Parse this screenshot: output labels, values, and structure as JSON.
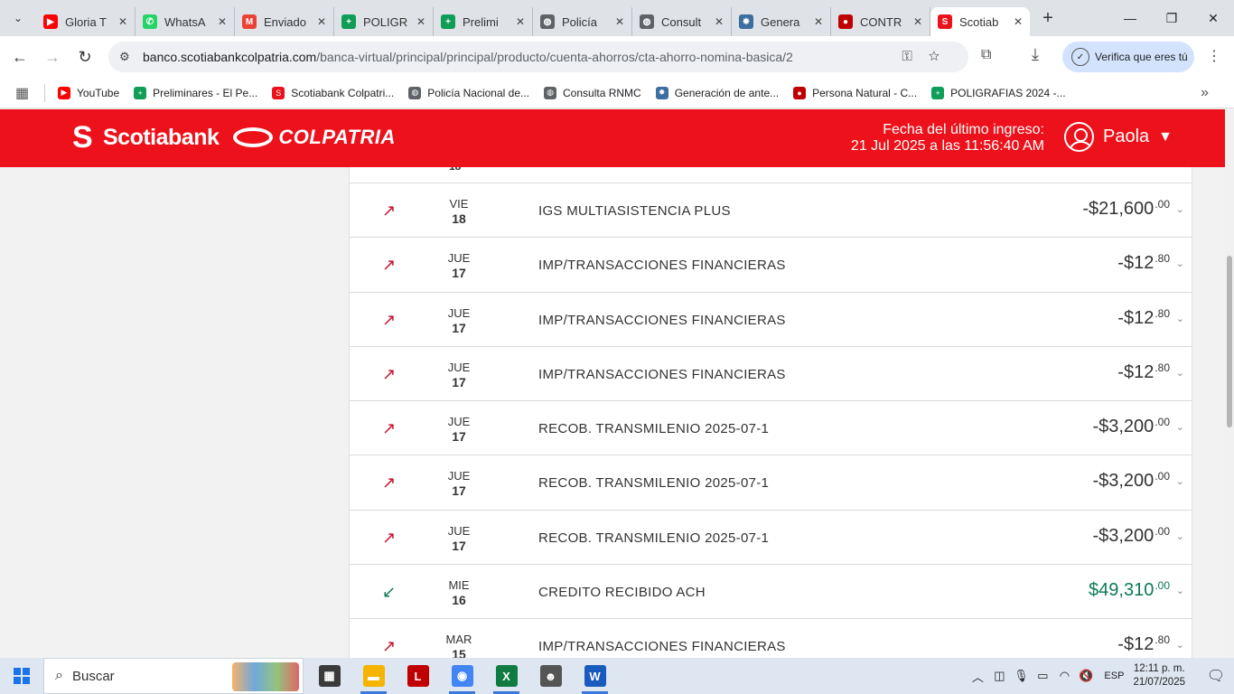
{
  "browser": {
    "tabs": [
      {
        "title": "Gloria T",
        "fav_color": "#ff0000",
        "fav_glyph": "▶"
      },
      {
        "title": "WhatsA",
        "fav_color": "#25d366",
        "fav_glyph": "✆"
      },
      {
        "title": "Enviado",
        "fav_color": "#ea4335",
        "fav_glyph": "M"
      },
      {
        "title": "POLIGR",
        "fav_color": "#0f9d58",
        "fav_glyph": "+"
      },
      {
        "title": "Prelimi",
        "fav_color": "#0f9d58",
        "fav_glyph": "+"
      },
      {
        "title": "Policía",
        "fav_color": "#5f6368",
        "fav_glyph": "◍"
      },
      {
        "title": "Consult",
        "fav_color": "#5f6368",
        "fav_glyph": "◍"
      },
      {
        "title": "Genera",
        "fav_color": "#3c6e9f",
        "fav_glyph": "✸"
      },
      {
        "title": "CONTR",
        "fav_color": "#c00000",
        "fav_glyph": "●"
      },
      {
        "title": "Scotiab",
        "fav_color": "#ec111a",
        "fav_glyph": "S",
        "active": true
      }
    ],
    "url_host": "banco.scotiabankcolpatria.com",
    "url_path": "/banca-virtual/principal/principal/producto/cuenta-ahorros/cta-ahorro-nomina-basica/2",
    "verify_label": "Verifica que eres tú",
    "bookmarks": [
      {
        "label": "YouTube",
        "color": "#ff0000",
        "glyph": "▶"
      },
      {
        "label": "Preliminares - El Pe...",
        "color": "#0f9d58",
        "glyph": "+"
      },
      {
        "label": "Scotiabank Colpatri...",
        "color": "#ec111a",
        "glyph": "S"
      },
      {
        "label": "Policía Nacional de...",
        "color": "#5f6368",
        "glyph": "◍"
      },
      {
        "label": "Consulta RNMC",
        "color": "#5f6368",
        "glyph": "◍"
      },
      {
        "label": "Generación de ante...",
        "color": "#3c6e9f",
        "glyph": "✸"
      },
      {
        "label": "Persona Natural - C...",
        "color": "#c00000",
        "glyph": "●"
      },
      {
        "label": "POLIGRAFIAS 2024 -...",
        "color": "#0f9d58",
        "glyph": "+"
      }
    ]
  },
  "header": {
    "brand1": "Scotiabank",
    "brand2": "COLPATRIA",
    "last_login_label": "Fecha del último ingreso:",
    "last_login_value": "21 Jul 2025 a las 11:56:40 AM",
    "user_name": "Paola"
  },
  "transactions_cut_day": "18",
  "transactions": [
    {
      "dir": "out",
      "weekday": "VIE",
      "day": "18",
      "desc": "IGS MULTIASISTENCIA PLUS",
      "amount": "-$21,600",
      "cents": ".00"
    },
    {
      "dir": "out",
      "weekday": "JUE",
      "day": "17",
      "desc": "IMP/TRANSACCIONES FINANCIERAS",
      "amount": "-$12",
      "cents": ".80"
    },
    {
      "dir": "out",
      "weekday": "JUE",
      "day": "17",
      "desc": "IMP/TRANSACCIONES FINANCIERAS",
      "amount": "-$12",
      "cents": ".80"
    },
    {
      "dir": "out",
      "weekday": "JUE",
      "day": "17",
      "desc": "IMP/TRANSACCIONES FINANCIERAS",
      "amount": "-$12",
      "cents": ".80"
    },
    {
      "dir": "out",
      "weekday": "JUE",
      "day": "17",
      "desc": "RECOB. TRANSMILENIO 2025-07-1",
      "amount": "-$3,200",
      "cents": ".00"
    },
    {
      "dir": "out",
      "weekday": "JUE",
      "day": "17",
      "desc": "RECOB. TRANSMILENIO 2025-07-1",
      "amount": "-$3,200",
      "cents": ".00"
    },
    {
      "dir": "out",
      "weekday": "JUE",
      "day": "17",
      "desc": "RECOB. TRANSMILENIO 2025-07-1",
      "amount": "-$3,200",
      "cents": ".00"
    },
    {
      "dir": "in",
      "weekday": "MIE",
      "day": "16",
      "desc": "CREDITO RECIBIDO ACH",
      "amount": "$49,310",
      "cents": ".00"
    },
    {
      "dir": "out",
      "weekday": "MAR",
      "day": "15",
      "desc": "IMP/TRANSACCIONES FINANCIERAS",
      "amount": "-$12",
      "cents": ".80"
    }
  ],
  "taskbar": {
    "search_placeholder": "Buscar",
    "apps": [
      {
        "name": "calculator",
        "color": "#3a3a3a",
        "glyph": "▦"
      },
      {
        "name": "file-explorer",
        "color": "#f4b400",
        "glyph": "▬",
        "running": true
      },
      {
        "name": "red-app",
        "color": "#c00000",
        "glyph": "L"
      },
      {
        "name": "chrome",
        "color": "#4285f4",
        "glyph": "◉",
        "running": true
      },
      {
        "name": "excel",
        "color": "#107c41",
        "glyph": "X",
        "running": true
      },
      {
        "name": "user-app",
        "color": "#555555",
        "glyph": "☻"
      },
      {
        "name": "word",
        "color": "#185abd",
        "glyph": "W",
        "running": true
      }
    ],
    "lang": "ESP",
    "time": "12:11 p. m.",
    "date": "21/07/2025"
  },
  "colors": {
    "brand_red": "#ec111a",
    "credit_green": "#0a7a57",
    "debit_arrow": "#c8102e"
  }
}
